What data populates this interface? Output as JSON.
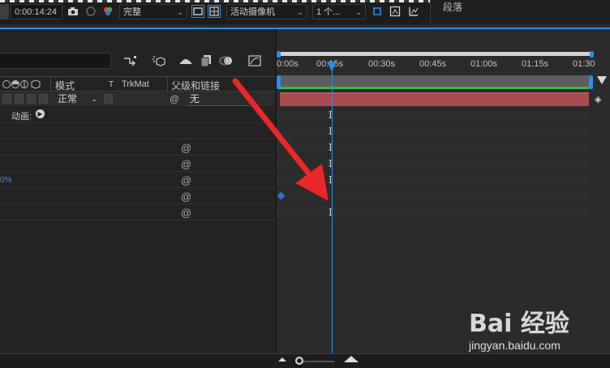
{
  "toolbar": {
    "timecode": "0:00:14:24",
    "quality": "完整",
    "camera": "活动摄像机",
    "views": "1 个..."
  },
  "right_panel": {
    "title": "段落"
  },
  "columns": {
    "mode": "模式",
    "t": "T",
    "trkmat": "TrkMat",
    "parent": "父级和链接"
  },
  "layer": {
    "mode_value": "正常",
    "parent_value": "无"
  },
  "properties": {
    "animate_label": "动画:",
    "percent_value": "0%"
  },
  "ruler": {
    "ticks": [
      "0:00s",
      "00:15s",
      "00:30s",
      "00:45s",
      "01:00s",
      "01:15s",
      "01:30"
    ]
  },
  "watermark": {
    "brand": "Bai 经验",
    "url": "jingyan.baidu.com"
  },
  "colors": {
    "accent": "#2d8ceb",
    "layer_bar": "#a94b4f",
    "work_area_green": "#3fb64a",
    "arrow": "#e8262b"
  }
}
